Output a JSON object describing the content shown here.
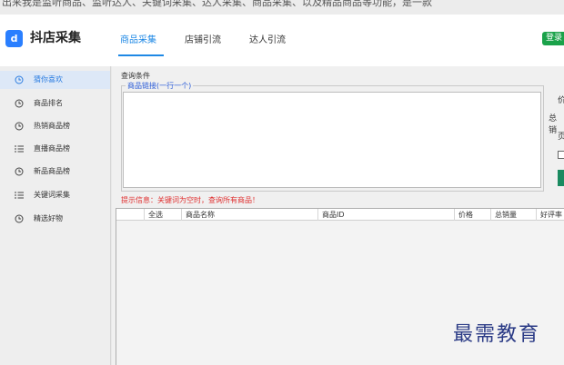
{
  "top_strip_text": "出来我是监听商品、监听达人、关键词采集、达人采集、商品采集、以及精品商品等功能，是一款",
  "app": {
    "title": "抖店采集",
    "logo_glyph": "d"
  },
  "tabs": [
    {
      "label": "商品采集",
      "active": true
    },
    {
      "label": "店铺引流",
      "active": false
    },
    {
      "label": "达人引流",
      "active": false
    }
  ],
  "login_label": "登录",
  "sidebar": {
    "items": [
      {
        "label": "猜你喜欢",
        "icon": "clock-icon",
        "active": true
      },
      {
        "label": "商品排名",
        "icon": "clock-icon",
        "active": false
      },
      {
        "label": "热销商品榜",
        "icon": "clock-icon",
        "active": false
      },
      {
        "label": "直播商品榜",
        "icon": "list-icon",
        "active": false
      },
      {
        "label": "新品商品榜",
        "icon": "clock-icon",
        "active": false
      },
      {
        "label": "关键词采集",
        "icon": "list-icon",
        "active": false
      },
      {
        "label": "精选好物",
        "icon": "clock-icon",
        "active": false
      }
    ]
  },
  "query": {
    "conditions_label": "查询条件",
    "link_group_label": "商品链接(一行一个)",
    "link_input_value": ""
  },
  "right_panel": {
    "price_label": "价",
    "total_sales_label": "总销",
    "page_label": "页"
  },
  "hint_text": "提示信息：关键词为空时，查询所有商品！",
  "table": {
    "columns": [
      "",
      "全选",
      "商品名称",
      "商品ID",
      "价格",
      "总销量",
      "好评率"
    ],
    "rows": []
  },
  "watermark_text": "最需教育",
  "colors": {
    "accent": "#1e88e5",
    "login": "#1aa24a",
    "hint": "#e03030",
    "legend": "#2a5bd7"
  }
}
